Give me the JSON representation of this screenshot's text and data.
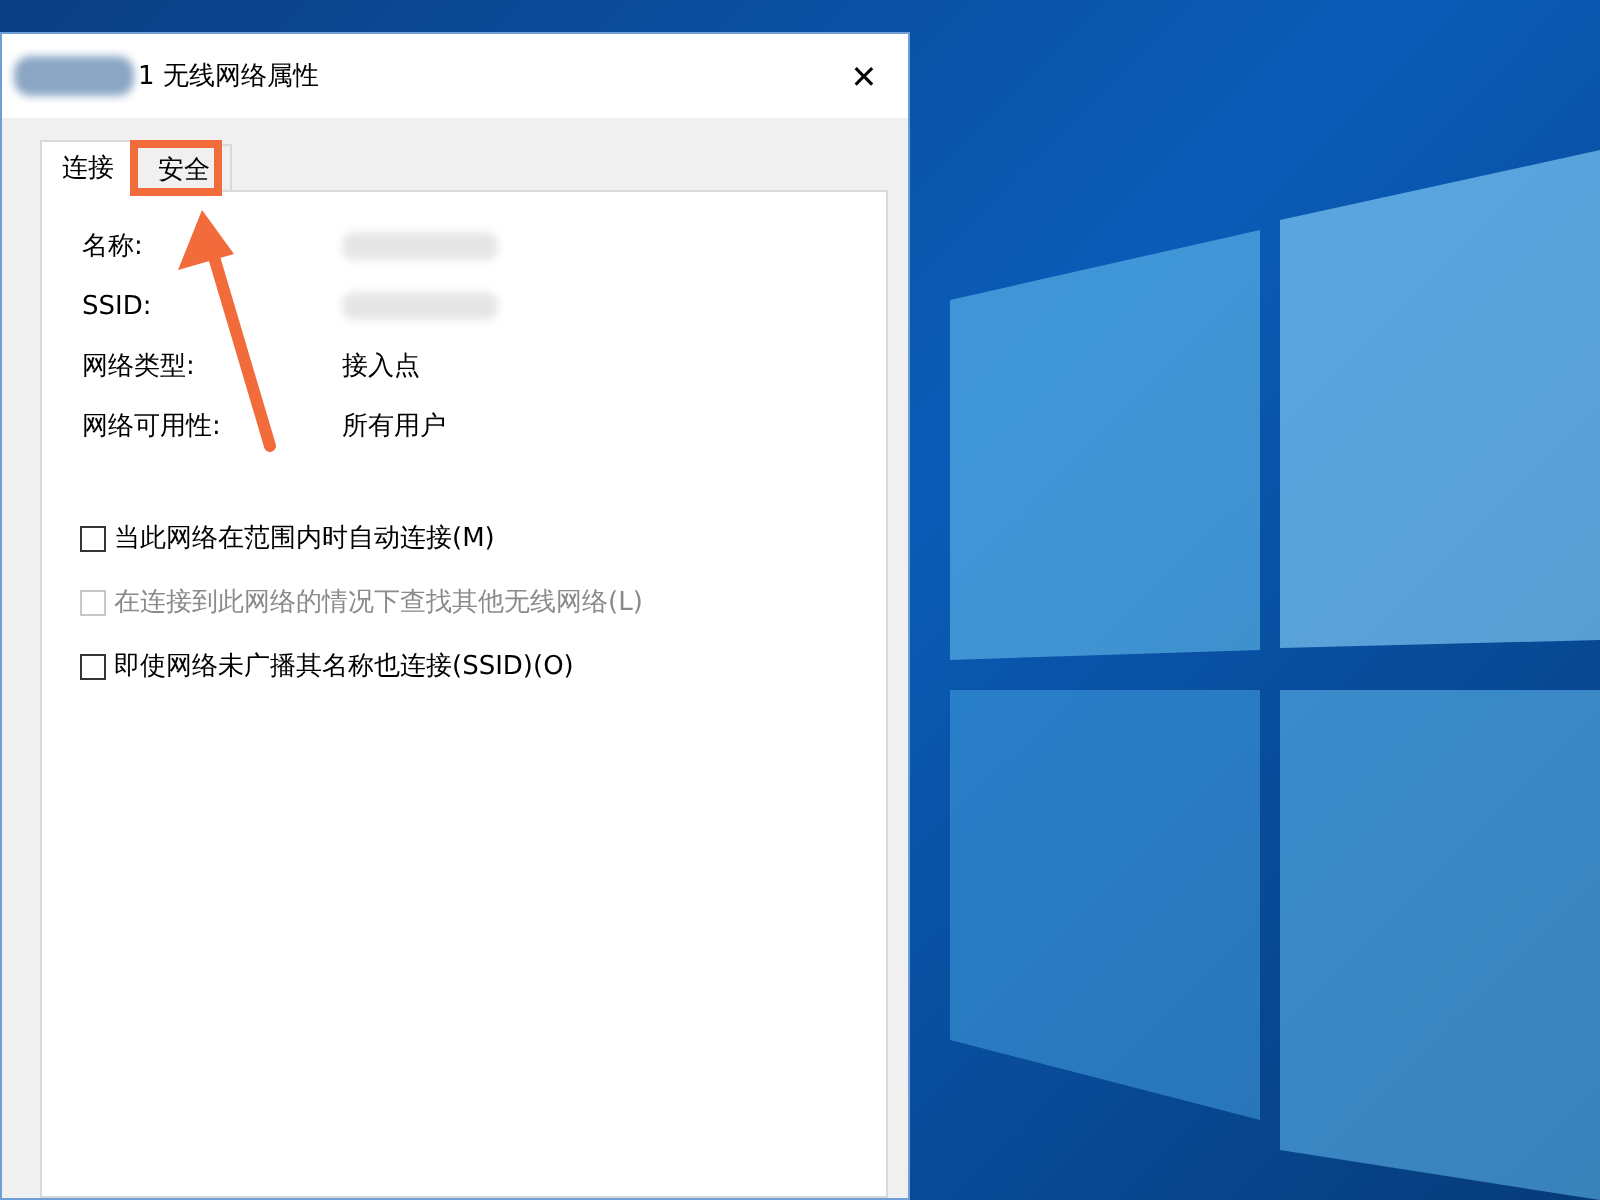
{
  "window": {
    "title": "1 无线网络属性",
    "title_blurred": true
  },
  "tabs": [
    {
      "label": "连接",
      "selected": true,
      "highlighted": false
    },
    {
      "label": "安全",
      "selected": false,
      "highlighted": true
    }
  ],
  "fields": [
    {
      "label": "名称:"
    },
    {
      "label": "SSID:"
    },
    {
      "label": "网络类型:",
      "value": "接入点"
    },
    {
      "label": "网络可用性:",
      "value": "所有用户"
    }
  ],
  "options": [
    {
      "label": "当此网络在范围内时自动连接(M)",
      "checked": false,
      "disabled": false
    },
    {
      "label": "在连接到此网络的情况下查找其他无线网络(L)",
      "checked": false,
      "disabled": true
    },
    {
      "label": "即使网络未广播其名称也连接(SSID)(O)",
      "checked": false,
      "disabled": false
    }
  ],
  "close_glyph": "✕"
}
